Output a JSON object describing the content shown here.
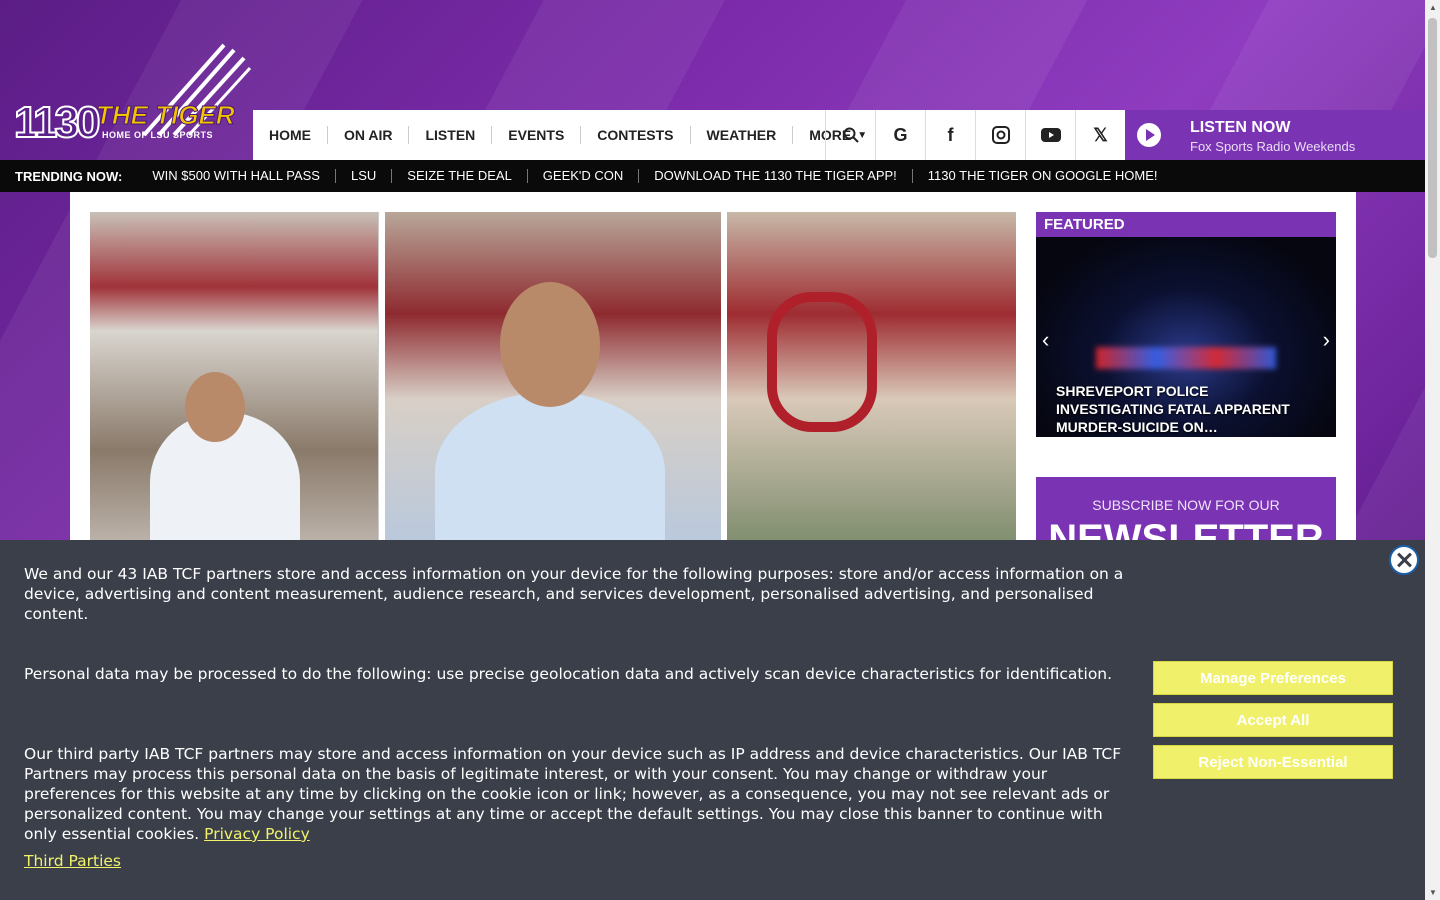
{
  "logo": {
    "number": "1130",
    "name": "THE TIGER",
    "tagline": "HOME OF LSU SPORTS"
  },
  "nav": {
    "items": [
      {
        "label": "HOME"
      },
      {
        "label": "ON AIR"
      },
      {
        "label": "LISTEN"
      },
      {
        "label": "EVENTS"
      },
      {
        "label": "CONTESTS"
      },
      {
        "label": "WEATHER"
      },
      {
        "label": "MORE"
      }
    ],
    "icons": [
      "search-icon",
      "google-icon",
      "facebook-icon",
      "instagram-icon",
      "youtube-icon",
      "x-icon"
    ]
  },
  "listen": {
    "title": "LISTEN NOW",
    "subtitle": "Fox Sports Radio Weekends"
  },
  "trending": {
    "label": "TRENDING NOW:",
    "items": [
      "WIN $500 WITH HALL PASS",
      "LSU",
      "SEIZE THE DEAL",
      "GEEK'D CON",
      "DOWNLOAD THE 1130 THE TIGER APP!",
      "1130 THE TIGER ON GOOGLE HOME!"
    ]
  },
  "featured": {
    "heading": "FEATURED",
    "caption": "SHREVEPORT POLICE INVESTIGATING FATAL APPARENT MURDER-SUICIDE ON…"
  },
  "newsletter": {
    "line1": "SUBSCRIBE NOW FOR OUR",
    "line2": "NEWSLETTER"
  },
  "cookie": {
    "p1": "We and our 43 IAB TCF partners store and access information on your device for the following purposes: store and/or access information on a device, advertising and content measurement, audience research, and services development, personalised advertising, and personalised content.",
    "p2": "Personal data may be processed to do the following: use precise geolocation data and actively scan device characteristics for identification.",
    "p3": "Our third party IAB TCF partners may store and access information on your device such as IP address and device characteristics. Our IAB TCF Partners may process this personal data on the basis of legitimate interest, or with your consent. You may change or withdraw your preferences for this website at any time by clicking on the cookie icon or link; however, as a consequence, you may not see relevant ads or personalized content. You may change your settings at any time or accept the default settings. You may close this banner to continue with only essential cookies.",
    "privacy_link": "Privacy Policy",
    "third_parties": "Third Parties",
    "buttons": {
      "manage": "Manage Preferences",
      "accept": "Accept All",
      "reject": "Reject Non-Essential"
    },
    "accent": "#f0f06a"
  },
  "colors": {
    "brand": "#7a34b3",
    "banner_bg": "#3a3f4a"
  }
}
